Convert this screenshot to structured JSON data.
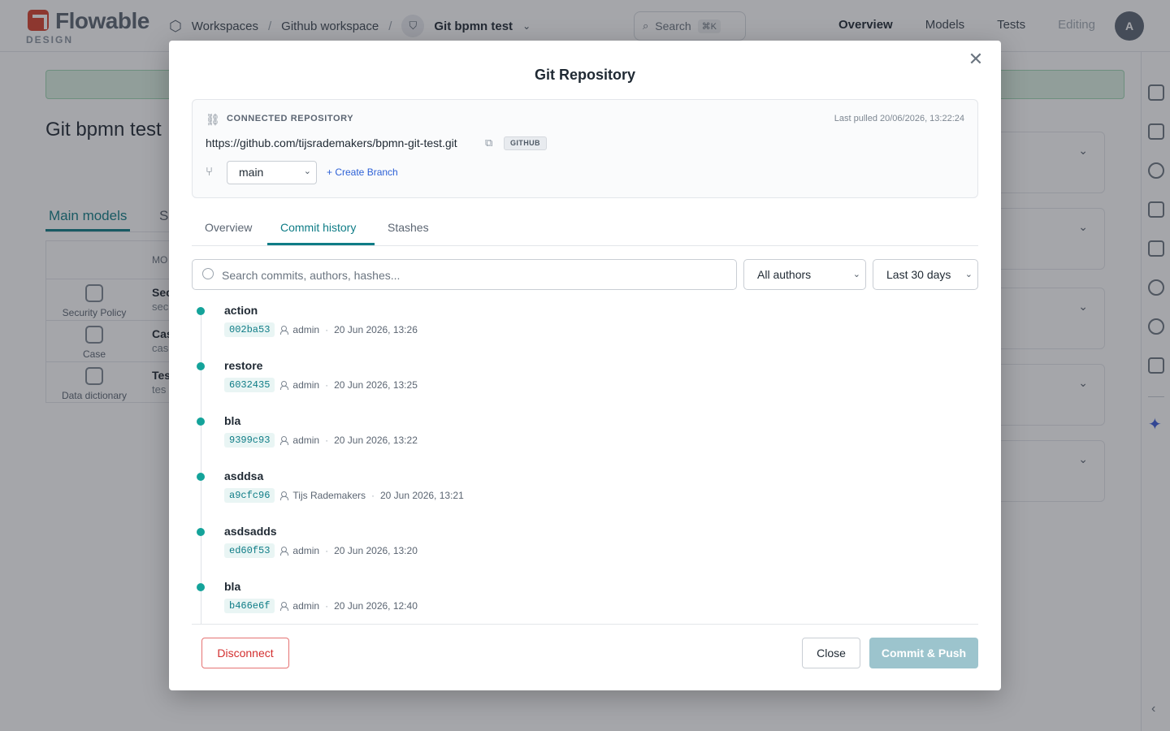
{
  "app": {
    "logo_text": "Flowable",
    "logo_sub": "DESIGN",
    "breadcrumb": {
      "workspaces": "Workspaces",
      "workspace": "Github workspace",
      "project": "Git bpmn test"
    },
    "search": {
      "label": "Search",
      "shortcut": "⌘K"
    },
    "nav": {
      "overview": "Overview",
      "models": "Models",
      "tests": "Tests",
      "editing": "Editing"
    },
    "avatar_initial": "A"
  },
  "background": {
    "page_title": "Git bpmn test",
    "tabs": {
      "main": "Main models",
      "secondary": "S"
    },
    "table_header": "MO",
    "rows": [
      {
        "label": "Security Policy",
        "name": "Sec",
        "sub": "sec",
        "icon": "security-policy-icon"
      },
      {
        "label": "Case",
        "name": "Cas",
        "sub": "cas",
        "icon": "case-icon"
      },
      {
        "label": "Data dictionary",
        "name": "Tes",
        "sub": "tes",
        "icon": "data-dictionary-icon"
      }
    ]
  },
  "modal": {
    "title": "Git Repository",
    "close_glyph": "✕",
    "repo": {
      "section_label": "CONNECTED REPOSITORY",
      "last_pulled": "Last pulled 20/06/2026, 13:22:24",
      "url": "https://github.com/tijsrademakers/bpmn-git-test.git",
      "provider": "GITHUB",
      "branch": "main",
      "create_branch": "+ Create Branch"
    },
    "tabs": [
      {
        "label": "Overview",
        "active": false
      },
      {
        "label": "Commit history",
        "active": true
      },
      {
        "label": "Stashes",
        "active": false
      }
    ],
    "filters": {
      "search_placeholder": "Search commits, authors, hashes...",
      "authors": "All authors",
      "period": "Last 30 days"
    },
    "commits": [
      {
        "message": "action",
        "hash": "002ba53",
        "author": "admin",
        "date": "20 Jun 2026, 13:26"
      },
      {
        "message": "restore",
        "hash": "6032435",
        "author": "admin",
        "date": "20 Jun 2026, 13:25"
      },
      {
        "message": "bla",
        "hash": "9399c93",
        "author": "admin",
        "date": "20 Jun 2026, 13:22"
      },
      {
        "message": "asddsa",
        "hash": "a9cfc96",
        "author": "Tijs Rademakers",
        "date": "20 Jun 2026, 13:21"
      },
      {
        "message": "asdsadds",
        "hash": "ed60f53",
        "author": "admin",
        "date": "20 Jun 2026, 13:20"
      },
      {
        "message": "bla",
        "hash": "b466e6f",
        "author": "admin",
        "date": "20 Jun 2026, 12:40"
      }
    ],
    "footer": {
      "disconnect": "Disconnect",
      "close": "Close",
      "commit_push": "Commit & Push"
    }
  },
  "colors": {
    "accent": "#0e7c86",
    "timeline_dot": "#14a39a",
    "danger": "#d32f2f",
    "primary_disabled": "#9cc4cd",
    "link": "#2d61d6"
  }
}
